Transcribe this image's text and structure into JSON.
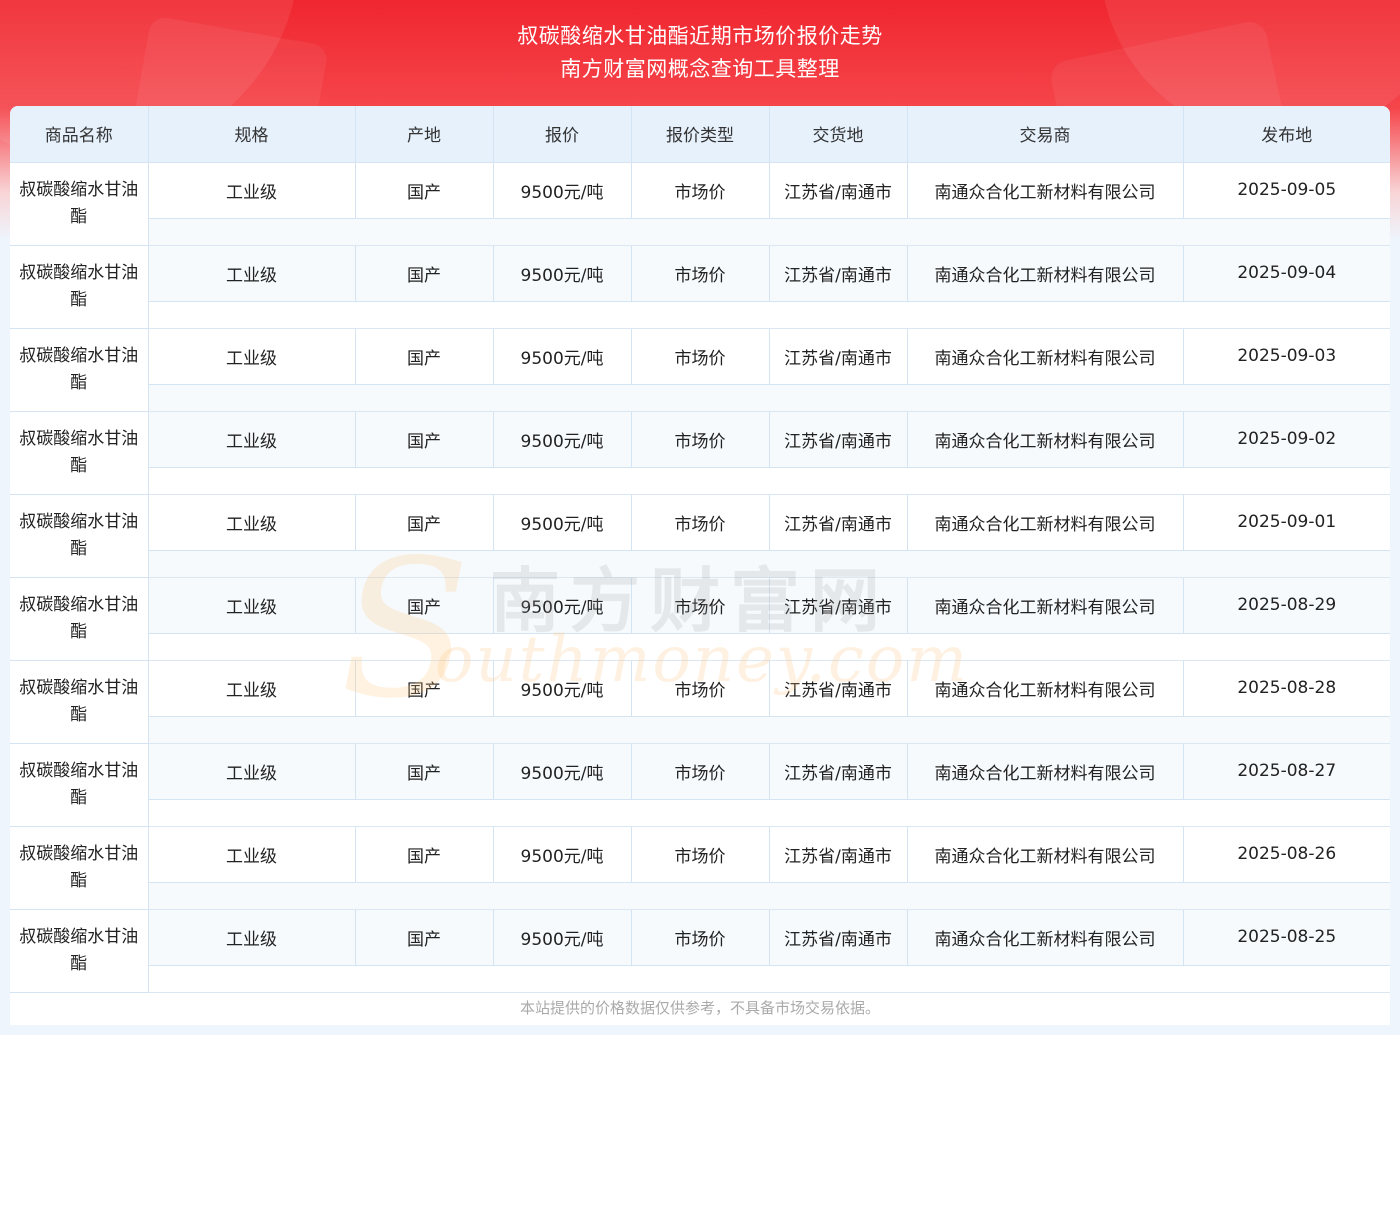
{
  "header": {
    "title": "叔碳酸缩水甘油酯近期市场价报价走势",
    "subtitle": "南方财富网概念查询工具整理"
  },
  "table": {
    "columns": [
      "商品名称",
      "规格",
      "产地",
      "报价",
      "报价类型",
      "交货地",
      "交易商",
      "发布地"
    ],
    "rows": [
      {
        "name": "叔碳酸缩水甘油酯",
        "spec": "工业级",
        "origin": "国产",
        "price": "9500元/吨",
        "price_type": "市场价",
        "delivery": "江苏省/南通市",
        "trader": "南通众合化工新材料有限公司",
        "date": "2025-09-05"
      },
      {
        "name": "叔碳酸缩水甘油酯",
        "spec": "工业级",
        "origin": "国产",
        "price": "9500元/吨",
        "price_type": "市场价",
        "delivery": "江苏省/南通市",
        "trader": "南通众合化工新材料有限公司",
        "date": "2025-09-04"
      },
      {
        "name": "叔碳酸缩水甘油酯",
        "spec": "工业级",
        "origin": "国产",
        "price": "9500元/吨",
        "price_type": "市场价",
        "delivery": "江苏省/南通市",
        "trader": "南通众合化工新材料有限公司",
        "date": "2025-09-03"
      },
      {
        "name": "叔碳酸缩水甘油酯",
        "spec": "工业级",
        "origin": "国产",
        "price": "9500元/吨",
        "price_type": "市场价",
        "delivery": "江苏省/南通市",
        "trader": "南通众合化工新材料有限公司",
        "date": "2025-09-02"
      },
      {
        "name": "叔碳酸缩水甘油酯",
        "spec": "工业级",
        "origin": "国产",
        "price": "9500元/吨",
        "price_type": "市场价",
        "delivery": "江苏省/南通市",
        "trader": "南通众合化工新材料有限公司",
        "date": "2025-09-01"
      },
      {
        "name": "叔碳酸缩水甘油酯",
        "spec": "工业级",
        "origin": "国产",
        "price": "9500元/吨",
        "price_type": "市场价",
        "delivery": "江苏省/南通市",
        "trader": "南通众合化工新材料有限公司",
        "date": "2025-08-29"
      },
      {
        "name": "叔碳酸缩水甘油酯",
        "spec": "工业级",
        "origin": "国产",
        "price": "9500元/吨",
        "price_type": "市场价",
        "delivery": "江苏省/南通市",
        "trader": "南通众合化工新材料有限公司",
        "date": "2025-08-28"
      },
      {
        "name": "叔碳酸缩水甘油酯",
        "spec": "工业级",
        "origin": "国产",
        "price": "9500元/吨",
        "price_type": "市场价",
        "delivery": "江苏省/南通市",
        "trader": "南通众合化工新材料有限公司",
        "date": "2025-08-27"
      },
      {
        "name": "叔碳酸缩水甘油酯",
        "spec": "工业级",
        "origin": "国产",
        "price": "9500元/吨",
        "price_type": "市场价",
        "delivery": "江苏省/南通市",
        "trader": "南通众合化工新材料有限公司",
        "date": "2025-08-26"
      },
      {
        "name": "叔碳酸缩水甘油酯",
        "spec": "工业级",
        "origin": "国产",
        "price": "9500元/吨",
        "price_type": "市场价",
        "delivery": "江苏省/南通市",
        "trader": "南通众合化工新材料有限公司",
        "date": "2025-08-25"
      }
    ]
  },
  "watermark": {
    "letter": "S",
    "cn": "南方财富网",
    "en": "outhmoney.com"
  },
  "footer": {
    "disclaimer": "本站提供的价格数据仅供参考，不具备市场交易依据。"
  },
  "colors": {
    "banner_red": "#f0262f",
    "header_bg": "#e6f1fc",
    "page_bg": "#eef5fc",
    "border": "#d5e4f3"
  }
}
